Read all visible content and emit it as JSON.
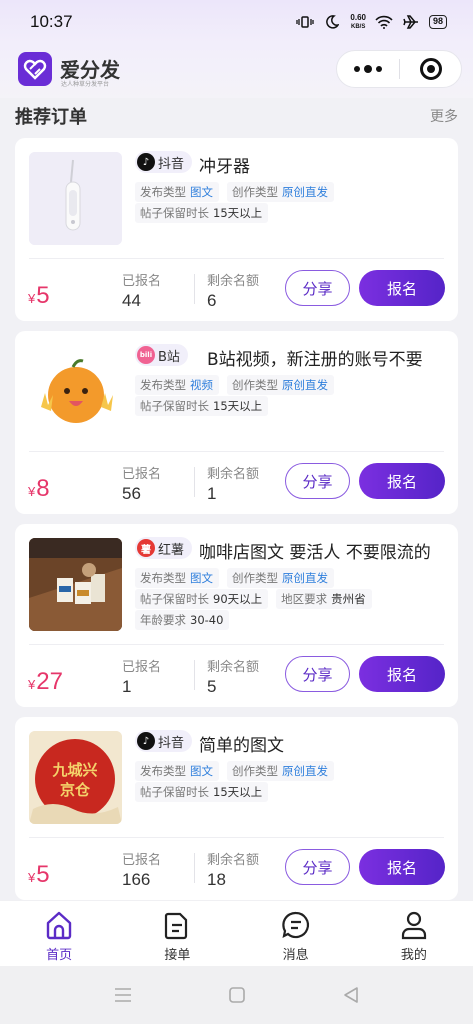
{
  "status_bar": {
    "time": "10:37",
    "net_speed_value": "0.60",
    "net_speed_unit": "KB/S",
    "battery": "98",
    "icons": [
      "vibrate-icon",
      "moon-icon",
      "wifi-icon",
      "airplane-icon",
      "battery-icon"
    ]
  },
  "header": {
    "app_name": "爱分发",
    "app_slogan": "达人种草分发平台",
    "brand_color": "#6a2dd6"
  },
  "section": {
    "title": "推荐订单",
    "more": "更多"
  },
  "labels": {
    "publish_type": "发布类型",
    "create_type": "创作类型",
    "retention": "帖子保留时长",
    "region": "地区要求",
    "age": "年龄要求",
    "joined": "已报名",
    "remaining": "剩余名额",
    "share": "分享",
    "join": "报名",
    "currency": "¥"
  },
  "orders": [
    {
      "platform": "抖音",
      "title": "冲牙器",
      "publish_type": "图文",
      "create_type": "原创直发",
      "retention": "15天以上",
      "price": "5",
      "joined": "44",
      "remaining": "6"
    },
    {
      "platform": "B站",
      "title": "B站视频，新注册的账号不要",
      "publish_type": "视频",
      "create_type": "原创直发",
      "retention": "15天以上",
      "price": "8",
      "joined": "56",
      "remaining": "1"
    },
    {
      "platform": "红薯",
      "title": "咖啡店图文 要活人 不要限流的",
      "publish_type": "图文",
      "create_type": "原创直发",
      "retention": "90天以上",
      "region": "贵州省",
      "age": "30-40",
      "price": "27",
      "joined": "1",
      "remaining": "5"
    },
    {
      "platform": "抖音",
      "title": "简单的图文",
      "publish_type": "图文",
      "create_type": "原创直发",
      "retention": "15天以上",
      "price": "5",
      "joined": "166",
      "remaining": "18",
      "thumb_text_line1": "九城兴",
      "thumb_text_line2": "京仓"
    }
  ],
  "tabbar": {
    "items": [
      {
        "label": "首页",
        "icon": "home-icon",
        "active": true
      },
      {
        "label": "接单",
        "icon": "order-doc-icon",
        "active": false
      },
      {
        "label": "消息",
        "icon": "message-icon",
        "active": false
      },
      {
        "label": "我的",
        "icon": "profile-icon",
        "active": false
      }
    ],
    "active_color": "#5b2bc6"
  },
  "colors": {
    "accent": "#6a2dd6",
    "price": "#e6366a",
    "tag_blue": "#2f7fdc",
    "tiktok": "#111111",
    "bilibili": "#f06292",
    "xiaohongshu": "#e53935"
  }
}
